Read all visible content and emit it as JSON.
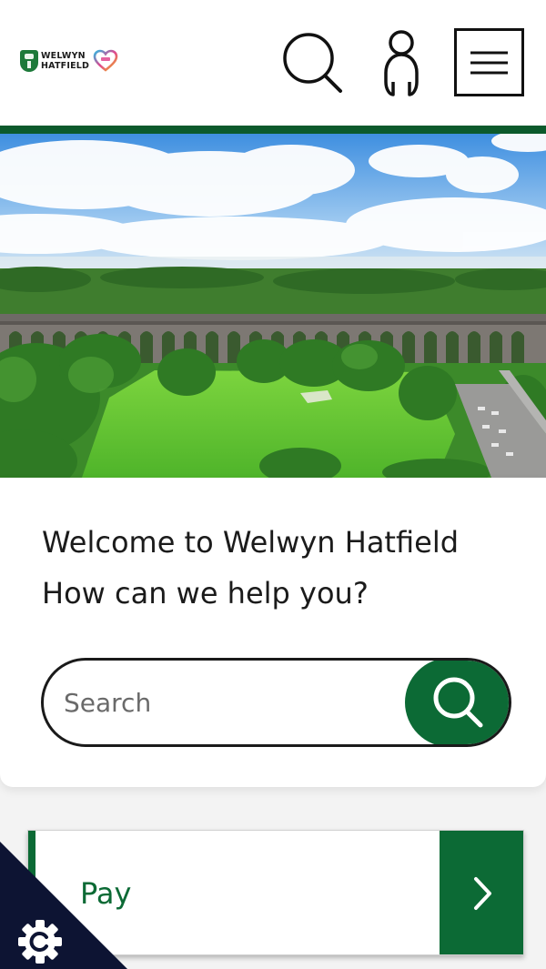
{
  "header": {
    "logo": {
      "line1": "WELWYN",
      "line2": "HATFIELD"
    },
    "search_icon": "search-icon",
    "account_icon": "user-icon",
    "menu_icon": "hamburger-menu-icon"
  },
  "hero": {
    "image": "viaduct-landscape-photo"
  },
  "welcome": {
    "title": "Welcome to Welwyn Hatfield",
    "subtitle": "How can we help you?"
  },
  "search": {
    "placeholder": "Search",
    "value": "",
    "button_icon": "search-icon"
  },
  "quick_links": [
    {
      "label": "Pay",
      "icon": "chevron-right-icon"
    }
  ],
  "cookie": {
    "icon": "cookie-settings-icon"
  },
  "colors": {
    "brand_green": "#0c6a35",
    "header_rule": "#0c5a2c",
    "cookie_navy": "#0d1433"
  }
}
